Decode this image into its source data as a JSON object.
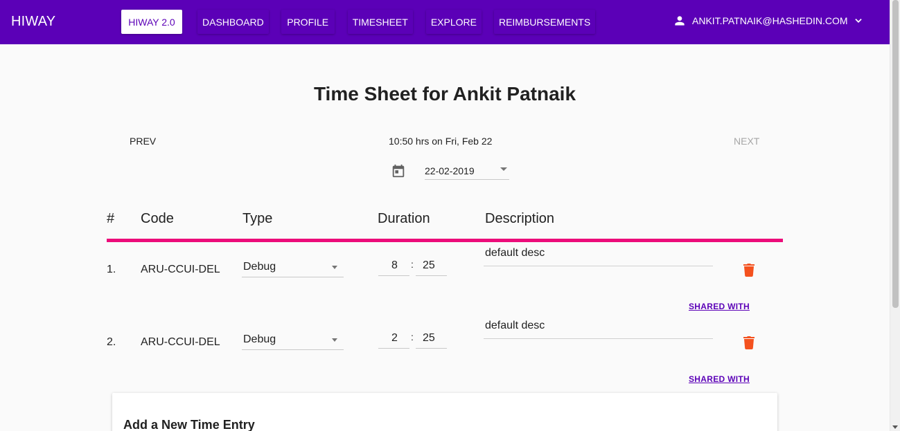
{
  "app": {
    "brand": "HIWAY"
  },
  "nav": [
    {
      "label": "HIWAY 2.0",
      "active": true
    },
    {
      "label": "DASHBOARD",
      "active": false
    },
    {
      "label": "PROFILE",
      "active": false
    },
    {
      "label": "TIMESHEET",
      "active": false
    },
    {
      "label": "EXPLORE",
      "active": false
    },
    {
      "label": "REIMBURSEMENTS",
      "active": false
    }
  ],
  "user": {
    "email": "ANKIT.PATNAIK@HASHEDIN.COM",
    "icon": "person-icon",
    "menu_icon": "chevron-down-icon"
  },
  "page": {
    "title": "Time Sheet for Ankit Patnaik",
    "prev_label": "PREV",
    "next_label": "NEXT",
    "hours_summary": "10:50 hrs on Fri, Feb 22",
    "date_value": "22-02-2019"
  },
  "table": {
    "headers": [
      "#",
      "Code",
      "Type",
      "Duration",
      "Description"
    ],
    "rows": [
      {
        "index": "1.",
        "code": "ARU-CCUI-DEL",
        "type": "Debug",
        "hours": "8",
        "minutes": "25",
        "description": "default desc",
        "shared_label": "SHARED WITH"
      },
      {
        "index": "2.",
        "code": "ARU-CCUI-DEL",
        "type": "Debug",
        "hours": "2",
        "minutes": "25",
        "description": "default desc",
        "shared_label": "SHARED WITH"
      }
    ]
  },
  "new_entry": {
    "title": "Add a New Time Entry"
  },
  "colors": {
    "appbar": "#5b00b7",
    "accent_line": "#ec0c7a",
    "delete": "#f4511e",
    "link": "#5b00b7"
  }
}
